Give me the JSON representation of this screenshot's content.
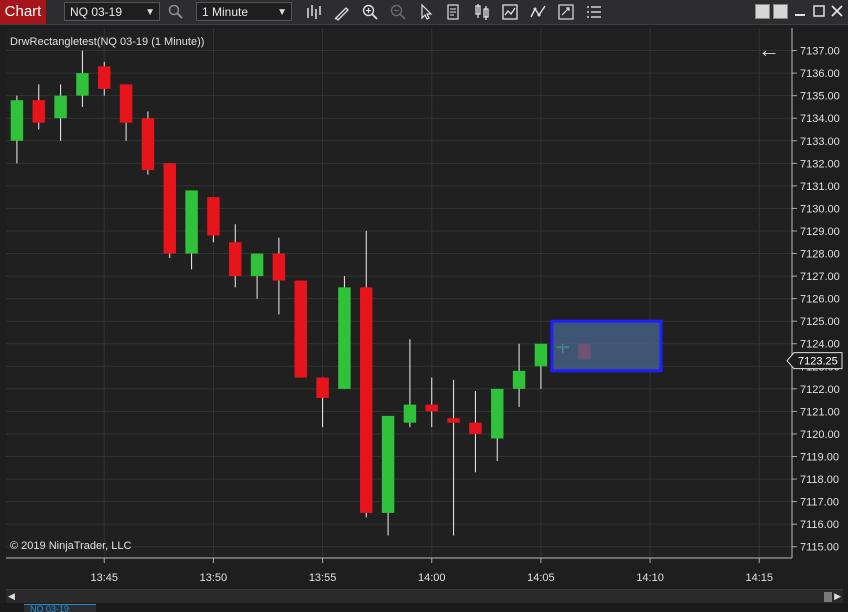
{
  "toolbar": {
    "app_title": "Chart",
    "instrument": "NQ 03-19",
    "interval": "1 Minute",
    "icons": [
      "search-icon",
      "bar-type-icon",
      "drawing-tool-icon",
      "zoom-in-icon",
      "zoom-out-icon",
      "pointer-icon",
      "data-box-icon",
      "chart-style-icon",
      "indicators-icon",
      "strategies-icon",
      "properties-icon",
      "menu-icon"
    ],
    "window_buttons": [
      "minimize",
      "maximize",
      "restore",
      "close"
    ]
  },
  "chart": {
    "label": "DrwRectangletest(NQ 03-19 (1 Minute))",
    "copyright": "© 2019 NinjaTrader, LLC",
    "current_price": "7123.25",
    "back_arrow": "←"
  },
  "bottom": {
    "tab_label": "NQ 03-19"
  },
  "colors": {
    "up": "#2fc23a",
    "down": "#e8141b",
    "background": "#202020",
    "grid": "#333333",
    "rectangle_fill": "#4a6790",
    "rectangle_border": "#1e1eff",
    "price_marker_bg": "#1e1e1e"
  },
  "chart_data": {
    "type": "candlestick",
    "ylim": [
      7114.5,
      7138.0
    ],
    "y_ticks": [
      "7115.00",
      "7116.00",
      "7117.00",
      "7118.00",
      "7119.00",
      "7120.00",
      "7121.00",
      "7122.00",
      "7123.00",
      "7124.00",
      "7125.00",
      "7126.00",
      "7127.00",
      "7128.00",
      "7129.00",
      "7130.00",
      "7131.00",
      "7132.00",
      "7133.00",
      "7134.00",
      "7135.00",
      "7136.00",
      "7137.00"
    ],
    "x_ticks": [
      "13:45",
      "13:50",
      "13:55",
      "14:00",
      "14:05",
      "14:10",
      "14:15"
    ],
    "x_tick_index": [
      4,
      9,
      14,
      19,
      24,
      29,
      34
    ],
    "x_range": [
      -0.5,
      35.5
    ],
    "grid": true,
    "candles": [
      {
        "o": 7133.0,
        "h": 7135.0,
        "l": 7132.0,
        "c": 7134.8
      },
      {
        "o": 7134.8,
        "h": 7135.5,
        "l": 7133.5,
        "c": 7133.8
      },
      {
        "o": 7134.0,
        "h": 7135.5,
        "l": 7133.0,
        "c": 7135.0
      },
      {
        "o": 7135.0,
        "h": 7137.0,
        "l": 7134.5,
        "c": 7136.0
      },
      {
        "o": 7136.3,
        "h": 7136.5,
        "l": 7135.0,
        "c": 7135.3
      },
      {
        "o": 7135.5,
        "h": 7135.5,
        "l": 7133.0,
        "c": 7133.8
      },
      {
        "o": 7134.0,
        "h": 7134.3,
        "l": 7131.5,
        "c": 7131.7
      },
      {
        "o": 7132.0,
        "h": 7132.0,
        "l": 7127.8,
        "c": 7128.0
      },
      {
        "o": 7128.0,
        "h": 7130.8,
        "l": 7127.3,
        "c": 7130.8
      },
      {
        "o": 7130.5,
        "h": 7130.5,
        "l": 7128.5,
        "c": 7128.8
      },
      {
        "o": 7128.5,
        "h": 7129.3,
        "l": 7126.5,
        "c": 7127.0
      },
      {
        "o": 7127.0,
        "h": 7128.0,
        "l": 7126.0,
        "c": 7128.0
      },
      {
        "o": 7128.0,
        "h": 7128.7,
        "l": 7125.3,
        "c": 7126.8
      },
      {
        "o": 7126.8,
        "h": 7126.8,
        "l": 7122.5,
        "c": 7122.5
      },
      {
        "o": 7122.5,
        "h": 7122.5,
        "l": 7120.3,
        "c": 7121.6
      },
      {
        "o": 7122.0,
        "h": 7127.0,
        "l": 7122.0,
        "c": 7126.5
      },
      {
        "o": 7126.5,
        "h": 7129.0,
        "l": 7116.3,
        "c": 7116.5
      },
      {
        "o": 7116.5,
        "h": 7120.8,
        "l": 7115.5,
        "c": 7120.8
      },
      {
        "o": 7120.5,
        "h": 7124.2,
        "l": 7120.3,
        "c": 7121.3
      },
      {
        "o": 7121.3,
        "h": 7122.5,
        "l": 7120.3,
        "c": 7121.0
      },
      {
        "o": 7120.7,
        "h": 7122.4,
        "l": 7115.5,
        "c": 7120.5
      },
      {
        "o": 7120.5,
        "h": 7121.9,
        "l": 7118.3,
        "c": 7120.0
      },
      {
        "o": 7119.8,
        "h": 7122.0,
        "l": 7118.8,
        "c": 7122.0
      },
      {
        "o": 7122.0,
        "h": 7124.0,
        "l": 7121.2,
        "c": 7122.8
      },
      {
        "o": 7123.0,
        "h": 7124.0,
        "l": 7122.0,
        "c": 7124.0
      },
      {
        "o": 7123.8,
        "h": 7124.0,
        "l": 7123.6,
        "c": 7123.9
      },
      {
        "o": 7124.0,
        "h": 7124.0,
        "l": 7123.3,
        "c": 7123.3
      }
    ],
    "rectangle": {
      "x_from": 24.5,
      "x_to": 29.5,
      "y_from": 7122.8,
      "y_to": 7125.0
    },
    "last_price": 7123.25
  }
}
